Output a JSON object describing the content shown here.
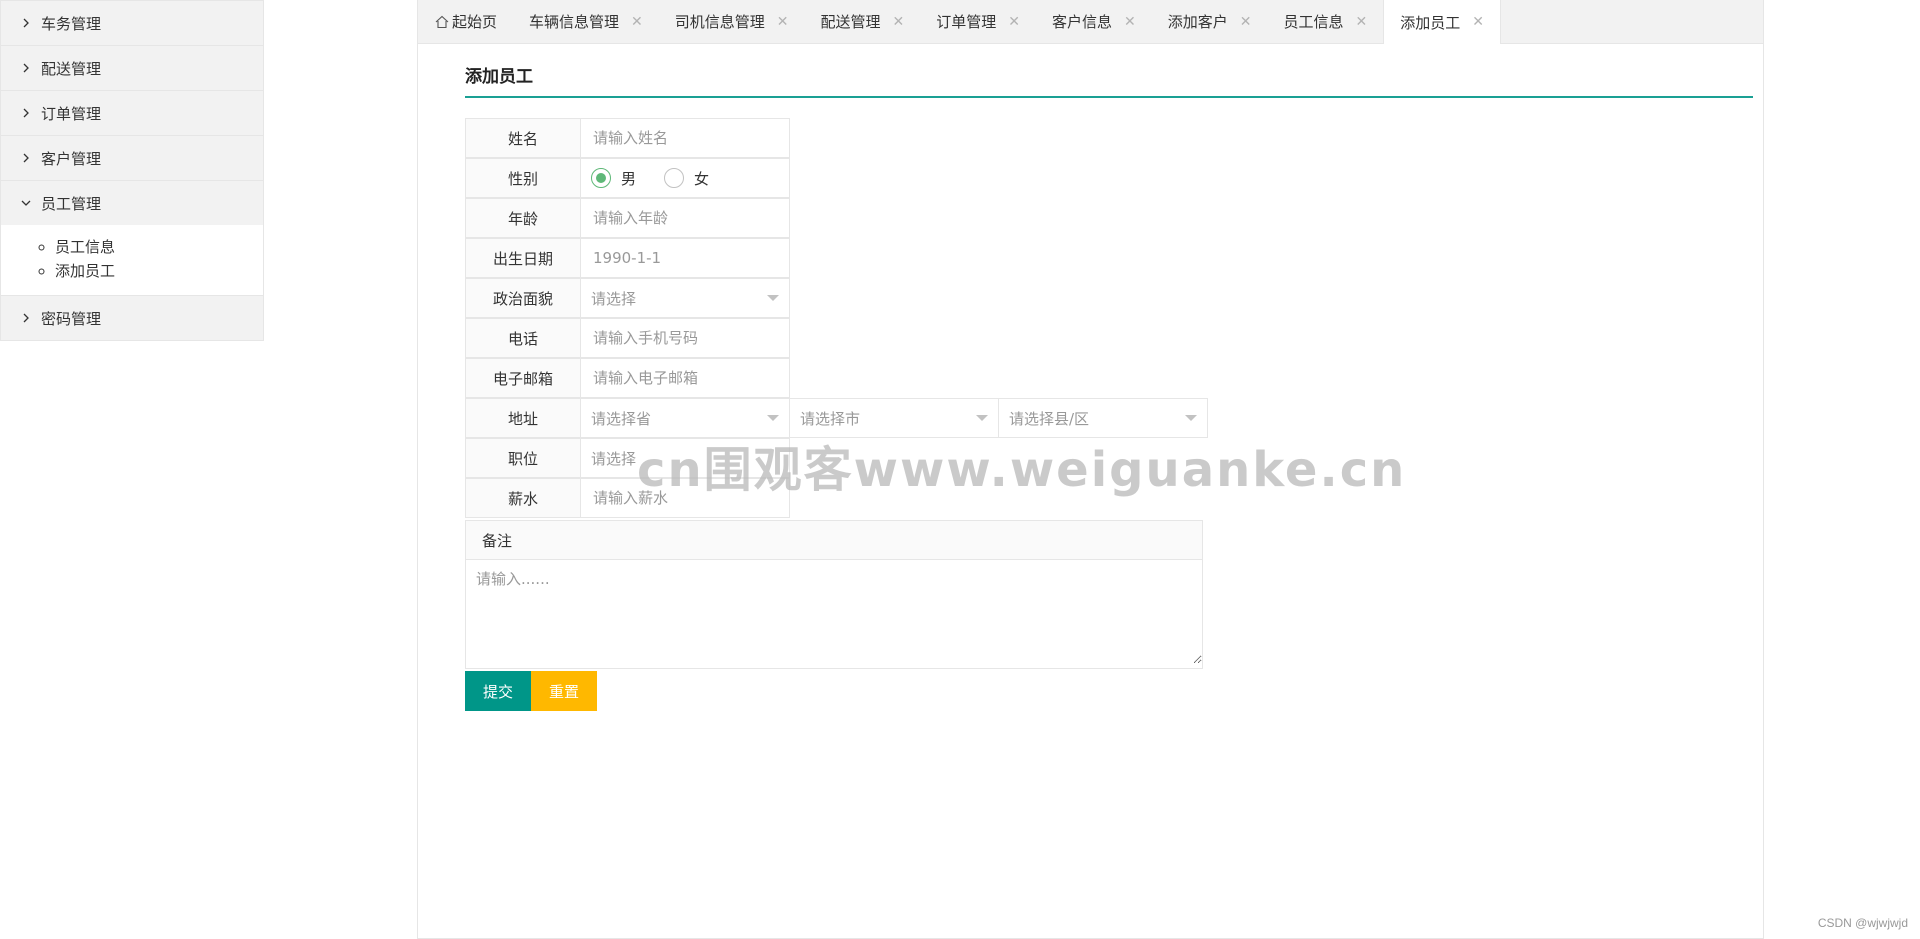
{
  "sidebar": {
    "items": [
      {
        "label": "车务管理",
        "expanded": false
      },
      {
        "label": "配送管理",
        "expanded": false
      },
      {
        "label": "订单管理",
        "expanded": false
      },
      {
        "label": "客户管理",
        "expanded": false
      },
      {
        "label": "员工管理",
        "expanded": true,
        "children": [
          "员工信息",
          "添加员工"
        ]
      },
      {
        "label": "密码管理",
        "expanded": false
      }
    ]
  },
  "tabs": [
    {
      "label": "起始页",
      "icon": "home-icon",
      "closable": false,
      "active": false
    },
    {
      "label": "车辆信息管理",
      "closable": true,
      "active": false
    },
    {
      "label": "司机信息管理",
      "closable": true,
      "active": false
    },
    {
      "label": "配送管理",
      "closable": true,
      "active": false
    },
    {
      "label": "订单管理",
      "closable": true,
      "active": false
    },
    {
      "label": "客户信息",
      "closable": true,
      "active": false
    },
    {
      "label": "添加客户",
      "closable": true,
      "active": false
    },
    {
      "label": "员工信息",
      "closable": true,
      "active": false
    },
    {
      "label": "添加员工",
      "closable": true,
      "active": true
    }
  ],
  "section_title": "添加员工",
  "form": {
    "name": {
      "label": "姓名",
      "placeholder": "请输入姓名"
    },
    "gender": {
      "label": "性别",
      "options": [
        "男",
        "女"
      ],
      "selected": "男"
    },
    "age": {
      "label": "年龄",
      "placeholder": "请输入年龄"
    },
    "birthdate": {
      "label": "出生日期",
      "placeholder": "1990-1-1"
    },
    "politics": {
      "label": "政治面貌",
      "placeholder": "请选择"
    },
    "phone": {
      "label": "电话",
      "placeholder": "请输入手机号码"
    },
    "email": {
      "label": "电子邮箱",
      "placeholder": "请输入电子邮箱"
    },
    "address": {
      "label": "地址",
      "province": "请选择省",
      "city": "请选择市",
      "county": "请选择县/区"
    },
    "position": {
      "label": "职位",
      "placeholder": "请选择"
    },
    "salary": {
      "label": "薪水",
      "placeholder": "请输入薪水"
    },
    "remark": {
      "label": "备注",
      "placeholder": "请输入......"
    }
  },
  "buttons": {
    "submit": "提交",
    "reset": "重置"
  },
  "watermark": "cn围观客www.weiguanke.cn",
  "credit": "CSDN @wjwjwjd",
  "colors": {
    "accent": "#009688",
    "warn": "#ffb800",
    "radio": "#5fb878",
    "title_line": "#1aa094"
  }
}
